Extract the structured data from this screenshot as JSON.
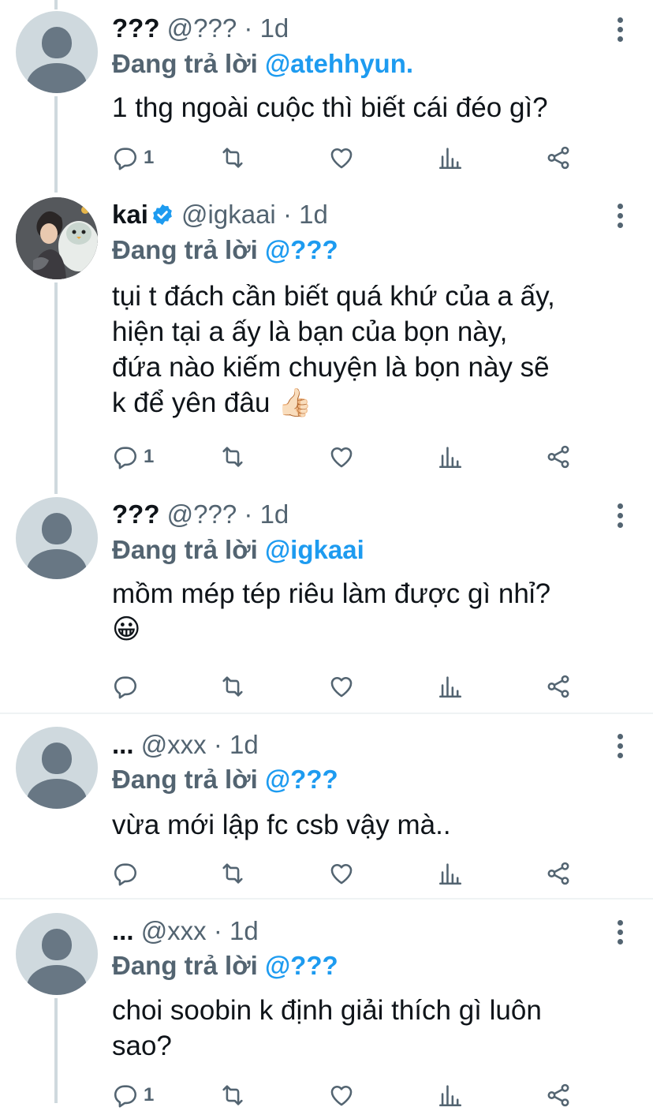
{
  "tweets": [
    {
      "name": "???",
      "handle": "@???",
      "dot": "·",
      "time": "1d",
      "verified": false,
      "reply_prefix": "Đang trả lời",
      "reply_to": "@atehhyun.",
      "text": "1 thg ngoài cuộc thì biết cái đéo gì?",
      "reply_count": "1"
    },
    {
      "name": "kai",
      "handle": "@igkaai",
      "dot": "·",
      "time": "1d",
      "verified": true,
      "reply_prefix": "Đang trả lời",
      "reply_to": "@???",
      "text": "tụi t đách cần biết quá khứ của a ấy,\nhiện tại a ấy là bạn của bọn này,\nđứa nào kiếm chuyện là bọn này sẽ\nk để yên đâu 👍🏻",
      "reply_count": "1"
    },
    {
      "name": "???",
      "handle": "@???",
      "dot": "·",
      "time": "1d",
      "verified": false,
      "reply_prefix": "Đang trả lời",
      "reply_to": "@igkaai",
      "text": "mồm mép tép riêu làm được gì nhỉ?\n😀",
      "reply_count": ""
    },
    {
      "name": "...",
      "handle": "@xxx",
      "dot": "·",
      "time": "1d",
      "verified": false,
      "reply_prefix": "Đang trả lời",
      "reply_to": "@???",
      "text": "vừa mới lập fc csb vậy mà..",
      "reply_count": ""
    },
    {
      "name": "...",
      "handle": "@xxx",
      "dot": "·",
      "time": "1d",
      "verified": false,
      "reply_prefix": "Đang trả lời",
      "reply_to": "@???",
      "text": "choi soobin k định giải thích gì luôn\nsao?",
      "reply_count": "1"
    }
  ],
  "icons": {
    "reply": "reply-icon",
    "retweet": "retweet-icon",
    "like": "heart-icon",
    "views": "analytics-icon",
    "share": "share-icon",
    "more": "more-dots-icon",
    "verified": "verified-badge-icon"
  },
  "colors": {
    "accent": "#1d9bf0",
    "secondary_text": "#536471",
    "thread_line": "#cfd9de"
  }
}
